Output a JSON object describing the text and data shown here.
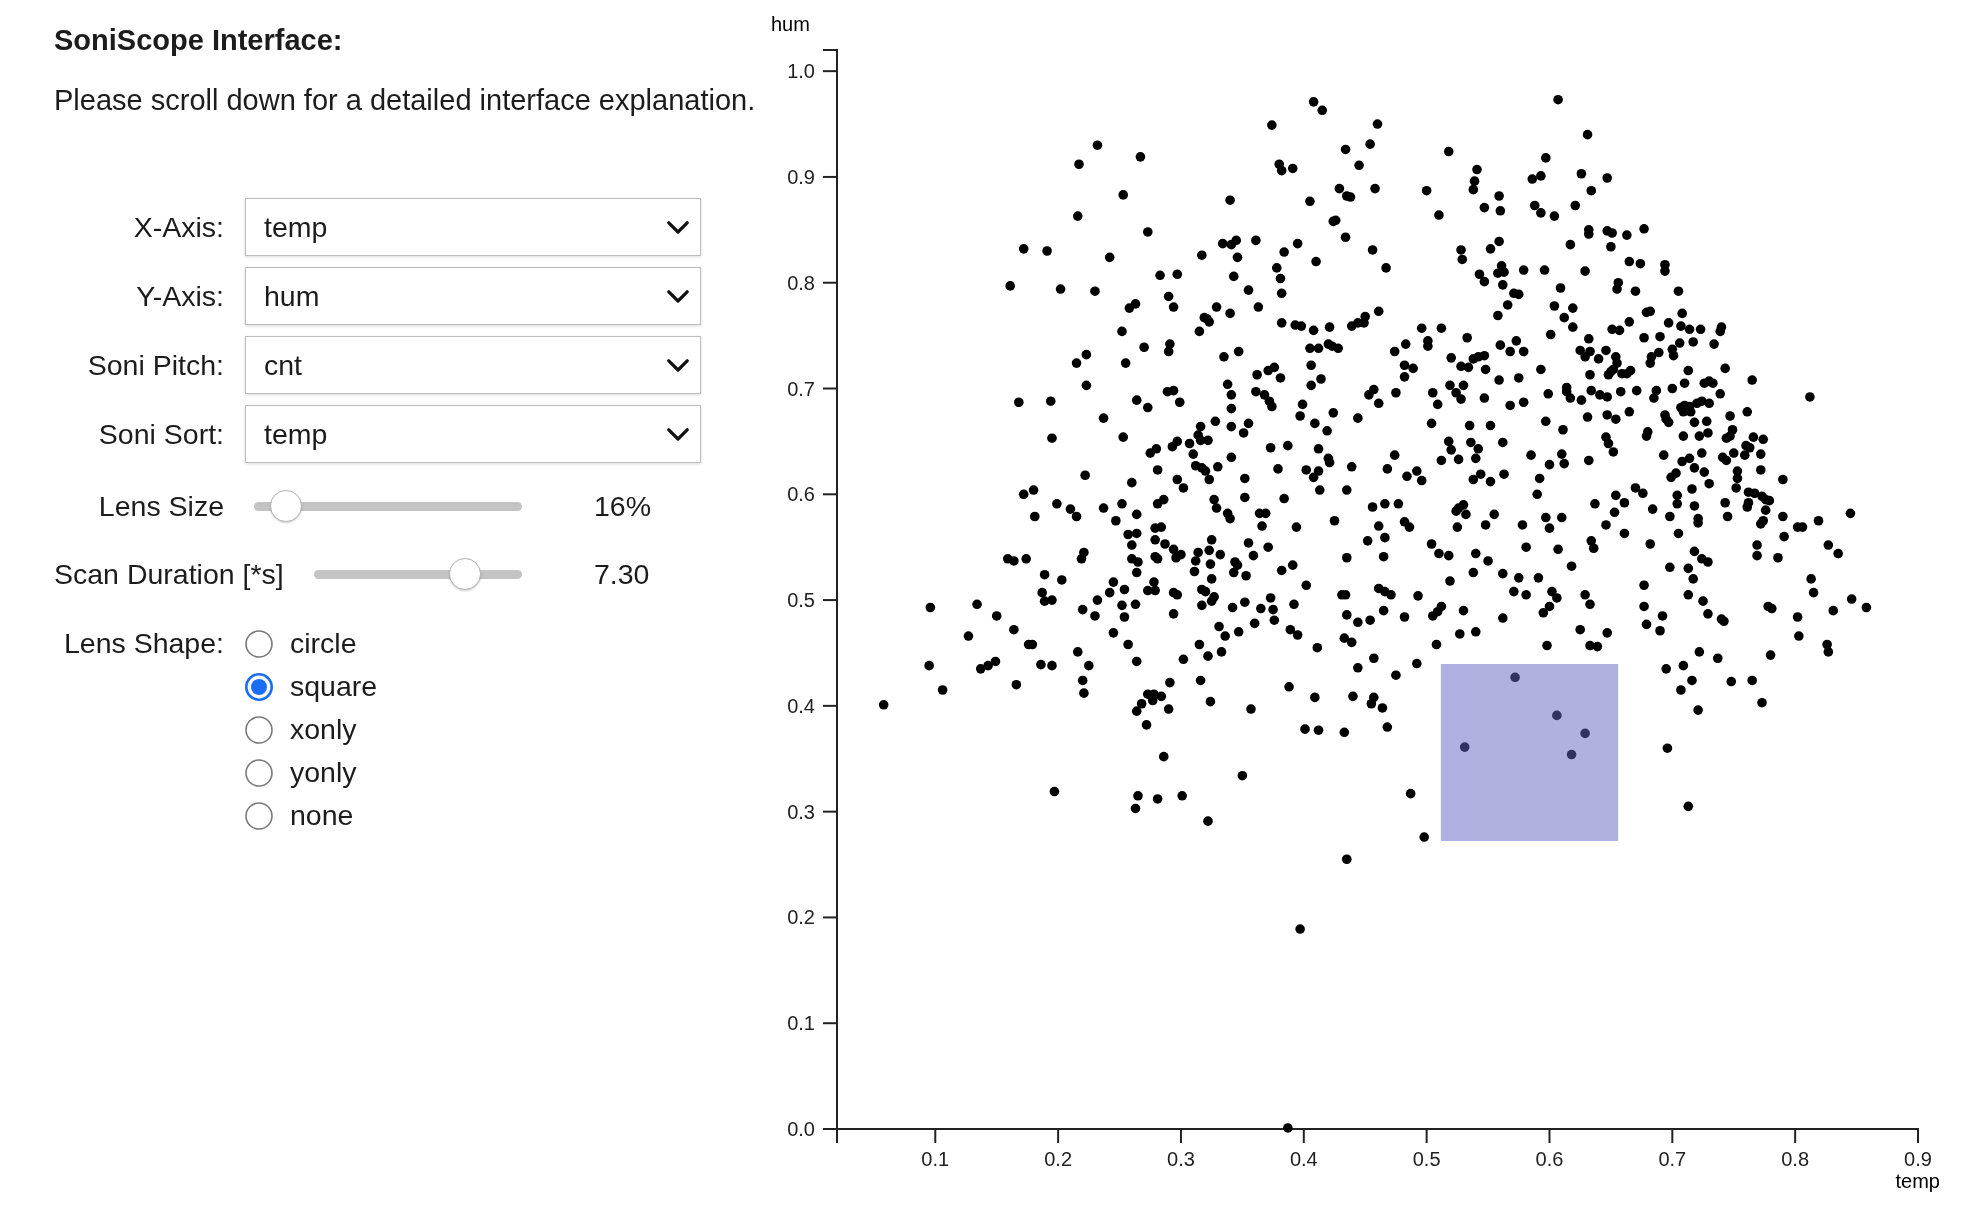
{
  "header": {
    "title": "SoniScope Interface:",
    "note": "Please scroll down for a detailed interface explanation."
  },
  "selects": [
    {
      "label": "X-Axis:",
      "value": "temp"
    },
    {
      "label": "Y-Axis:",
      "value": "hum"
    },
    {
      "label": "Soni Pitch:",
      "value": "cnt"
    },
    {
      "label": "Soni Sort:",
      "value": "temp"
    }
  ],
  "sliders": [
    {
      "label": "Lens Size",
      "level": 0.12,
      "reading": "16%"
    },
    {
      "label": "Scan Duration [*s]",
      "level": 0.724,
      "reading": "7.30"
    }
  ],
  "lens_shape": {
    "label": "Lens Shape:",
    "options": [
      {
        "label": "circle",
        "selected": false
      },
      {
        "label": "square",
        "selected": true
      },
      {
        "label": "xonly",
        "selected": false
      },
      {
        "label": "yonly",
        "selected": false
      },
      {
        "label": "none",
        "selected": false
      }
    ]
  },
  "chart": {
    "chart_data": {
      "type": "scatter",
      "xlabel": "temp",
      "ylabel": "hum",
      "xlim": [
        0.02,
        0.9
      ],
      "ylim": [
        0,
        1.02
      ],
      "xticks": [
        0.1,
        0.2,
        0.3,
        0.4,
        0.5,
        0.6,
        0.7,
        0.8,
        0.9
      ],
      "yticks": [
        {
          "value": 0,
          "label": "0.0"
        },
        0.1,
        0.2,
        0.3,
        0.4,
        0.5,
        0.6,
        0.7,
        0.8,
        0.9,
        {
          "value": 1,
          "label": "1.0"
        }
      ],
      "x": [
        0.408,
        0.415,
        0.374,
        0.46,
        0.232,
        0.217,
        0.267,
        0.38,
        0.382,
        0.391,
        0.434,
        0.454,
        0.445,
        0.429,
        0.435,
        0.438,
        0.458,
        0.253,
        0.34,
        0.405,
        0.216,
        0.424,
        0.426,
        0.273,
        0.434,
        0.172,
        0.191,
        0.242,
        0.317,
        0.334,
        0.341,
        0.345,
        0.361,
        0.346,
        0.384,
        0.395,
        0.41,
        0.456,
        0.467,
        0.161,
        0.202,
        0.23,
        0.283,
        0.297,
        0.343,
        0.378,
        0.381,
        0.382,
        0.355,
        0.29,
        0.294,
        0.258,
        0.263,
        0.329,
        0.34,
        0.363,
        0.461,
        0.319,
        0.321,
        0.323,
        0.315,
        0.252,
        0.382,
        0.393,
        0.398,
        0.408,
        0.421,
        0.439,
        0.444,
        0.45,
        0.449,
        0.27,
        0.291,
        0.29,
        0.347,
        0.335,
        0.405,
        0.412,
        0.42,
        0.423,
        0.428,
        0.215,
        0.223,
        0.255,
        0.406,
        0.371,
        0.376,
        0.362,
        0.381,
        0.414,
        0.338,
        0.406,
        0.223,
        0.289,
        0.294,
        0.341,
        0.361,
        0.368,
        0.372,
        0.374,
        0.457,
        0.453,
        0.168,
        0.194,
        0.264,
        0.273,
        0.299,
        0.341,
        0.399,
        0.461,
        0.397,
        0.237,
        0.328,
        0.316,
        0.341,
        0.355,
        0.409,
        0.424,
        0.444,
        0.419,
        0.351,
        0.195,
        0.253,
        0.314,
        0.316,
        0.322,
        0.307,
        0.297,
        0.293,
        0.28,
        0.275,
        0.31,
        0.373,
        0.387,
        0.412,
        0.42,
        0.421,
        0.341,
        0.312,
        0.317,
        0.32,
        0.323,
        0.33,
        0.281,
        0.379,
        0.402,
        0.412,
        0.408,
        0.439,
        0.468,
        0.222,
        0.26,
        0.297,
        0.302,
        0.352,
        0.413,
        0.435,
        0.172,
        0.18,
        0.181,
        0.199,
        0.21,
        0.215,
        0.237,
        0.252,
        0.247,
        0.264,
        0.281,
        0.286,
        0.327,
        0.329,
        0.352,
        0.384,
        0.338,
        0.34,
        0.364,
        0.369,
        0.366,
        0.394,
        0.425,
        0.456,
        0.466,
        0.461,
        0.466,
        0.452,
        0.465,
        0.257,
        0.264,
        0.26,
        0.279,
        0.284,
        0.279,
        0.287,
        0.294,
        0.325,
        0.323,
        0.314,
        0.3,
        0.296,
        0.332,
        0.355,
        0.371,
        0.359,
        0.159,
        0.164,
        0.174,
        0.221,
        0.219,
        0.26,
        0.265,
        0.279,
        0.281,
        0.312,
        0.311,
        0.324,
        0.344,
        0.346,
        0.343,
        0.353,
        0.382,
        0.391,
        0.435,
        0.264,
        0.189,
        0.203,
        0.245,
        0.325,
        0.402,
        0.187,
        0.189,
        0.195,
        0.242,
        0.254,
        0.273,
        0.279,
        0.278,
        0.294,
        0.297,
        0.317,
        0.32,
        0.327,
        0.325,
        0.373,
        0.431,
        0.434,
        0.461,
        0.466,
        0.465,
        0.435,
        0.096,
        0.134,
        0.15,
        0.22,
        0.232,
        0.252,
        0.263,
        0.317,
        0.342,
        0.352,
        0.365,
        0.392,
        0.375,
        0.127,
        0.164,
        0.095,
        0.106,
        0.058,
        0.137,
        0.143,
        0.149,
        0.166,
        0.176,
        0.179,
        0.186,
        0.195,
        0.23,
        0.216,
        0.225,
        0.22,
        0.221,
        0.197,
        0.245,
        0.254,
        0.257,
        0.264,
        0.264,
        0.268,
        0.272,
        0.273,
        0.278,
        0.277,
        0.284,
        0.29,
        0.291,
        0.294,
        0.286,
        0.302,
        0.265,
        0.263,
        0.281,
        0.301,
        0.322,
        0.315,
        0.316,
        0.322,
        0.324,
        0.331,
        0.336,
        0.333,
        0.347,
        0.35,
        0.357,
        0.36,
        0.376,
        0.388,
        0.389,
        0.395,
        0.401,
        0.412,
        0.409,
        0.411,
        0.397,
        0.387,
        0.433,
        0.435,
        0.433,
        0.439,
        0.444,
        0.44,
        0.444,
        0.454,
        0.457,
        0.455,
        0.457,
        0.464,
        0.468,
        0.607,
        0.631,
        0.518,
        0.597,
        0.541,
        0.539,
        0.538,
        0.586,
        0.593,
        0.626,
        0.647,
        0.5,
        0.634,
        0.559,
        0.547,
        0.56,
        0.588,
        0.593,
        0.604,
        0.621,
        0.51,
        0.632,
        0.632,
        0.647,
        0.651,
        0.663,
        0.677,
        0.617,
        0.65,
        0.559,
        0.552,
        0.528,
        0.529,
        0.665,
        0.674,
        0.694,
        0.694,
        0.596,
        0.629,
        0.561,
        0.558,
        0.563,
        0.579,
        0.543,
        0.547,
        0.562,
        0.571,
        0.575,
        0.609,
        0.656,
        0.655,
        0.67,
        0.705,
        0.566,
        0.558,
        0.604,
        0.612,
        0.619,
        0.619,
        0.679,
        0.682,
        0.708,
        0.665,
        0.697,
        0.707,
        0.714,
        0.723,
        0.74,
        0.739,
        0.496,
        0.512,
        0.533,
        0.601,
        0.651,
        0.657,
        0.632,
        0.677,
        0.69,
        0.706,
        0.717,
        0.734,
        0.483,
        0.501,
        0.501,
        0.474,
        0.56,
        0.573,
        0.568,
        0.579,
        0.538,
        0.542,
        0.547,
        0.52,
        0.625,
        0.633,
        0.629,
        0.646,
        0.64,
        0.654,
        0.655,
        0.689,
        0.7,
        0.701,
        0.683,
        0.682,
        0.482,
        0.489,
        0.482,
        0.528,
        0.534,
        0.548,
        0.593,
        0.633,
        0.648,
        0.65,
        0.652,
        0.659,
        0.663,
        0.666,
        0.713,
        0.743,
        0.765,
        0.559,
        0.575,
        0.519,
        0.53,
        0.524,
        0.528,
        0.547,
        0.475,
        0.505,
        0.509,
        0.599,
        0.614,
        0.614,
        0.617,
        0.626,
        0.634,
        0.641,
        0.647,
        0.658,
        0.671,
        0.687,
        0.685,
        0.7,
        0.71,
        0.726,
        0.73,
        0.733,
        0.739,
        0.812,
        0.568,
        0.579,
        0.707,
        0.71,
        0.714,
        0.709,
        0.715,
        0.72,
        0.724,
        0.73,
        0.665,
        0.761,
        0.504,
        0.535,
        0.552,
        0.597,
        0.631,
        0.647,
        0.654,
        0.694,
        0.695,
        0.697,
        0.718,
        0.728,
        0.747,
        0.611,
        0.68,
        0.679,
        0.709,
        0.722,
        0.729,
        0.749,
        0.747,
        0.744,
        0.766,
        0.774,
        0.518,
        0.52,
        0.536,
        0.542,
        0.562,
        0.646,
        0.648,
        0.652,
        0.76,
        0.763,
        0.474,
        0.512,
        0.526,
        0.54,
        0.585,
        0.61,
        0.612,
        0.6,
        0.632,
        0.693,
        0.708,
        0.714,
        0.724,
        0.741,
        0.744,
        0.75,
        0.759,
        0.772,
        0.484,
        0.492,
        0.496,
        0.538,
        0.544,
        0.552,
        0.563,
        0.592,
        0.718,
        0.726,
        0.703,
        0.699,
        0.753,
        0.753,
        0.772,
        0.73,
        0.79,
        0.67,
        0.676,
        0.716,
        0.752,
        0.59,
        0.654,
        0.704,
        0.704,
        0.762,
        0.767,
        0.773,
        0.779,
        0.776,
        0.762,
        0.761,
        0.477,
        0.53,
        0.526,
        0.524,
        0.532,
        0.637,
        0.661,
        0.653,
        0.684,
        0.718,
        0.743,
        0.776,
        0.555,
        0.482,
        0.486,
        0.525,
        0.548,
        0.578,
        0.597,
        0.6,
        0.61,
        0.646,
        0.698,
        0.661,
        0.705,
        0.721,
        0.721,
        0.745,
        0.774,
        0.772,
        0.79,
        0.791,
        0.802,
        0.806,
        0.819,
        0.845,
        0.504,
        0.51,
        0.518,
        0.54,
        0.55,
        0.581,
        0.607,
        0.634,
        0.636,
        0.682,
        0.718,
        0.724,
        0.729,
        0.769,
        0.769,
        0.786,
        0.827,
        0.835,
        0.538,
        0.562,
        0.575,
        0.591,
        0.618,
        0.519,
        0.698,
        0.713,
        0.717,
        0.813,
        0.815,
        0.677,
        0.471,
        0.493,
        0.571,
        0.581,
        0.602,
        0.606,
        0.629,
        0.633,
        0.713,
        0.725,
        0.729,
        0.778,
        0.781,
        0.846,
        0.858,
        0.482,
        0.505,
        0.512,
        0.509,
        0.53,
        0.562,
        0.595,
        0.6,
        0.677,
        0.692,
        0.74,
        0.802,
        0.831,
        0.527,
        0.54,
        0.508,
        0.492,
        0.475,
        0.598,
        0.625,
        0.633,
        0.639,
        0.647,
        0.679,
        0.69,
        0.742,
        0.803,
        0.826,
        0.827,
        0.78,
        0.722,
        0.737,
        0.695,
        0.709,
        0.716,
        0.707,
        0.721,
        0.748,
        0.765,
        0.773,
        0.696,
        0.713,
        0.487,
        0.498,
        0.572,
        0.606,
        0.629,
        0.618,
        0.531
      ],
      "values": [
        0.971,
        0.963,
        0.949,
        0.95,
        0.93,
        0.912,
        0.919,
        0.912,
        0.906,
        0.908,
        0.926,
        0.931,
        0.911,
        0.889,
        0.882,
        0.881,
        0.889,
        0.883,
        0.878,
        0.877,
        0.863,
        0.858,
        0.859,
        0.848,
        0.843,
        0.832,
        0.83,
        0.824,
        0.826,
        0.837,
        0.836,
        0.84,
        0.84,
        0.824,
        0.829,
        0.837,
        0.82,
        0.831,
        0.814,
        0.797,
        0.794,
        0.792,
        0.807,
        0.808,
        0.806,
        0.814,
        0.804,
        0.79,
        0.793,
        0.787,
        0.777,
        0.776,
        0.78,
        0.777,
        0.771,
        0.777,
        0.773,
        0.767,
        0.766,
        0.763,
        0.754,
        0.754,
        0.762,
        0.76,
        0.759,
        0.755,
        0.758,
        0.759,
        0.762,
        0.768,
        0.762,
        0.739,
        0.742,
        0.735,
        0.735,
        0.73,
        0.738,
        0.738,
        0.742,
        0.74,
        0.738,
        0.724,
        0.732,
        0.724,
        0.722,
        0.717,
        0.72,
        0.713,
        0.71,
        0.709,
        0.704,
        0.703,
        0.703,
        0.697,
        0.698,
        0.694,
        0.697,
        0.694,
        0.688,
        0.683,
        0.699,
        0.694,
        0.687,
        0.688,
        0.689,
        0.682,
        0.687,
        0.681,
        0.685,
        0.686,
        0.674,
        0.672,
        0.669,
        0.664,
        0.664,
        0.667,
        0.667,
        0.677,
        0.672,
        0.66,
        0.658,
        0.653,
        0.654,
        0.656,
        0.651,
        0.651,
        0.648,
        0.65,
        0.645,
        0.643,
        0.639,
        0.638,
        0.644,
        0.646,
        0.643,
        0.634,
        0.63,
        0.635,
        0.627,
        0.625,
        0.622,
        0.614,
        0.626,
        0.623,
        0.624,
        0.623,
        0.622,
        0.616,
        0.626,
        0.624,
        0.618,
        0.611,
        0.614,
        0.606,
        0.615,
        0.604,
        0.604,
        0.6,
        0.604,
        0.579,
        0.591,
        0.586,
        0.579,
        0.587,
        0.591,
        0.575,
        0.581,
        0.591,
        0.595,
        0.595,
        0.587,
        0.597,
        0.596,
        0.582,
        0.577,
        0.582,
        0.582,
        0.57,
        0.569,
        0.575,
        0.588,
        0.591,
        0.57,
        0.559,
        0.556,
        0.541,
        0.562,
        0.563,
        0.552,
        0.568,
        0.569,
        0.557,
        0.553,
        0.548,
        0.557,
        0.547,
        0.545,
        0.543,
        0.54,
        0.543,
        0.554,
        0.55,
        0.542,
        0.539,
        0.537,
        0.539,
        0.545,
        0.539,
        0.539,
        0.536,
        0.541,
        0.539,
        0.537,
        0.527,
        0.534,
        0.536,
        0.533,
        0.526,
        0.523,
        0.528,
        0.533,
        0.54,
        0.526,
        0.524,
        0.519,
        0.517,
        0.52,
        0.514,
        0.507,
        0.499,
        0.5,
        0.507,
        0.51,
        0.509,
        0.509,
        0.517,
        0.507,
        0.505,
        0.51,
        0.508,
        0.503,
        0.499,
        0.502,
        0.505,
        0.505,
        0.511,
        0.508,
        0.49,
        0.486,
        0.493,
        0.496,
        0.485,
        0.491,
        0.5,
        0.495,
        0.496,
        0.495,
        0.493,
        0.498,
        0.492,
        0.496,
        0.491,
        0.466,
        0.472,
        0.438,
        0.415,
        0.401,
        0.435,
        0.438,
        0.442,
        0.42,
        0.458,
        0.458,
        0.439,
        0.438,
        0.485,
        0.451,
        0.438,
        0.424,
        0.412,
        0.319,
        0.469,
        0.484,
        0.458,
        0.442,
        0.395,
        0.402,
        0.382,
        0.411,
        0.411,
        0.405,
        0.409,
        0.397,
        0.422,
        0.487,
        0.352,
        0.444,
        0.315,
        0.303,
        0.312,
        0.315,
        0.291,
        0.458,
        0.424,
        0.447,
        0.404,
        0.475,
        0.466,
        0.451,
        0.47,
        0.334,
        0.397,
        0.478,
        0.481,
        0.418,
        0.472,
        0.467,
        0.378,
        0.377,
        0.408,
        0.455,
        0.189,
        0.001,
        0.375,
        0.255,
        0.464,
        0.46,
        0.479,
        0.409,
        0.436,
        0.481,
        0.445,
        0.402,
        0.408,
        0.398,
        0.38,
        0.973,
        0.94,
        0.924,
        0.918,
        0.907,
        0.896,
        0.888,
        0.898,
        0.901,
        0.903,
        0.899,
        0.887,
        0.887,
        0.882,
        0.871,
        0.868,
        0.873,
        0.866,
        0.863,
        0.873,
        0.864,
        0.85,
        0.846,
        0.849,
        0.847,
        0.845,
        0.851,
        0.836,
        0.834,
        0.839,
        0.832,
        0.831,
        0.822,
        0.82,
        0.818,
        0.817,
        0.811,
        0.812,
        0.811,
        0.816,
        0.809,
        0.81,
        0.812,
        0.808,
        0.801,
        0.798,
        0.79,
        0.789,
        0.795,
        0.8,
        0.794,
        0.792,
        0.792,
        0.779,
        0.769,
        0.778,
        0.767,
        0.776,
        0.758,
        0.772,
        0.773,
        0.771,
        0.763,
        0.762,
        0.759,
        0.756,
        0.756,
        0.758,
        0.754,
        0.757,
        0.757,
        0.748,
        0.751,
        0.756,
        0.755,
        0.747,
        0.748,
        0.749,
        0.743,
        0.744,
        0.742,
        0.742,
        0.745,
        0.74,
        0.735,
        0.741,
        0.745,
        0.735,
        0.735,
        0.728,
        0.73,
        0.731,
        0.729,
        0.736,
        0.735,
        0.73,
        0.736,
        0.728,
        0.73,
        0.724,
        0.734,
        0.737,
        0.731,
        0.73,
        0.724,
        0.722,
        0.719,
        0.711,
        0.721,
        0.72,
        0.718,
        0.718,
        0.713,
        0.713,
        0.716,
        0.718,
        0.714,
        0.714,
        0.717,
        0.717,
        0.719,
        0.708,
        0.708,
        0.71,
        0.703,
        0.703,
        0.696,
        0.69,
        0.691,
        0.696,
        0.696,
        0.685,
        0.695,
        0.701,
        0.697,
        0.691,
        0.689,
        0.698,
        0.694,
        0.692,
        0.697,
        0.698,
        0.698,
        0.691,
        0.7,
        0.705,
        0.705,
        0.707,
        0.705,
        0.695,
        0.692,
        0.684,
        0.687,
        0.682,
        0.684,
        0.683,
        0.678,
        0.678,
        0.686,
        0.688,
        0.686,
        0.678,
        0.678,
        0.667,
        0.665,
        0.665,
        0.669,
        0.673,
        0.675,
        0.671,
        0.675,
        0.671,
        0.668,
        0.668,
        0.669,
        0.674,
        0.661,
        0.659,
        0.655,
        0.655,
        0.655,
        0.658,
        0.661,
        0.655,
        0.653,
        0.654,
        0.652,
        0.65,
        0.642,
        0.649,
        0.643,
        0.649,
        0.654,
        0.648,
        0.64,
        0.646,
        0.644,
        0.637,
        0.632,
        0.633,
        0.634,
        0.637,
        0.638,
        0.629,
        0.628,
        0.632,
        0.637,
        0.631,
        0.634,
        0.639,
        0.635,
        0.632,
        0.639,
        0.637,
        0.638,
        0.617,
        0.622,
        0.613,
        0.614,
        0.619,
        0.612,
        0.619,
        0.615,
        0.625,
        0.621,
        0.62,
        0.616,
        0.622,
        0.615,
        0.623,
        0.61,
        0.614,
        0.606,
        0.601,
        0.605,
        0.606,
        0.6,
        0.599,
        0.599,
        0.591,
        0.602,
        0.601,
        0.598,
        0.594,
        0.595,
        0.592,
        0.588,
        0.591,
        0.59,
        0.587,
        0.584,
        0.581,
        0.591,
        0.592,
        0.583,
        0.586,
        0.589,
        0.592,
        0.585,
        0.581,
        0.574,
        0.569,
        0.569,
        0.571,
        0.571,
        0.578,
        0.568,
        0.578,
        0.571,
        0.579,
        0.563,
        0.563,
        0.577,
        0.573,
        0.579,
        0.575,
        0.572,
        0.579,
        0.56,
        0.569,
        0.569,
        0.575,
        0.582,
        0.553,
        0.544,
        0.542,
        0.544,
        0.537,
        0.55,
        0.548,
        0.556,
        0.549,
        0.553,
        0.546,
        0.539,
        0.536,
        0.552,
        0.542,
        0.54,
        0.552,
        0.544,
        0.526,
        0.525,
        0.521,
        0.521,
        0.532,
        0.518,
        0.531,
        0.53,
        0.52,
        0.52,
        0.507,
        0.514,
        0.505,
        0.504,
        0.508,
        0.505,
        0.508,
        0.502,
        0.505,
        0.496,
        0.505,
        0.499,
        0.487,
        0.494,
        0.492,
        0.501,
        0.493,
        0.484,
        0.485,
        0.494,
        0.489,
        0.49,
        0.483,
        0.488,
        0.494,
        0.494,
        0.485,
        0.482,
        0.484,
        0.49,
        0.468,
        0.47,
        0.458,
        0.44,
        0.429,
        0.457,
        0.472,
        0.457,
        0.456,
        0.469,
        0.477,
        0.471,
        0.48,
        0.466,
        0.458,
        0.451,
        0.448,
        0.451,
        0.445,
        0.435,
        0.438,
        0.424,
        0.415,
        0.396,
        0.423,
        0.424,
        0.403,
        0.36,
        0.305,
        0.317,
        0.276,
        0.427,
        0.391,
        0.374,
        0.354,
        0.361
      ]
    }
  }
}
